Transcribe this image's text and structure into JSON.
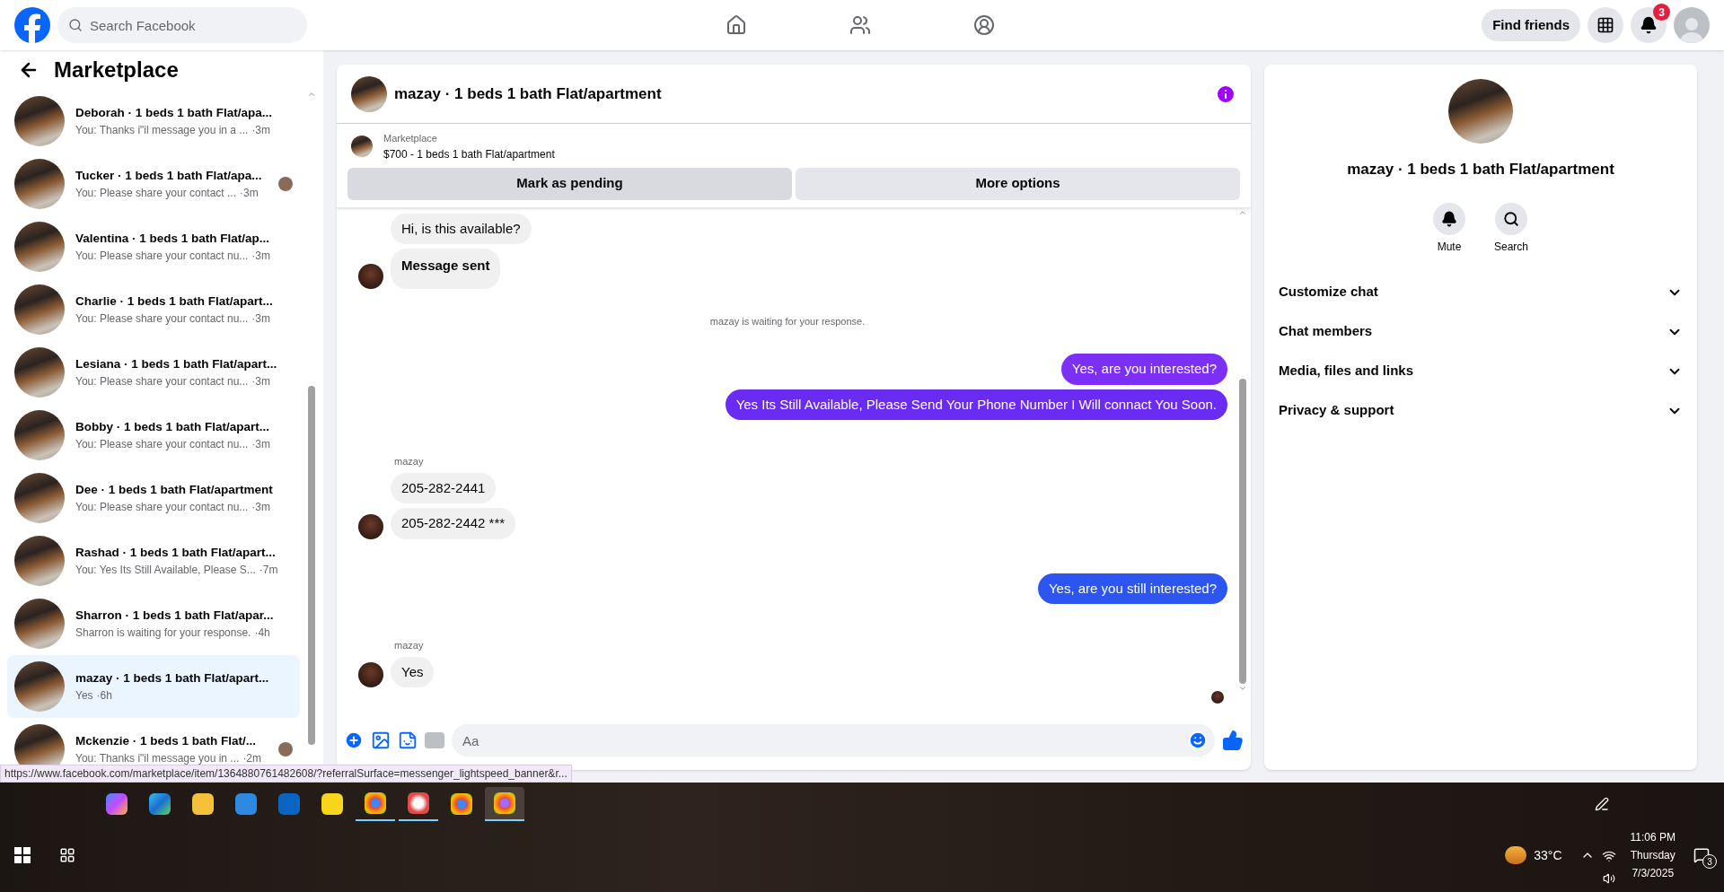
{
  "topbar": {
    "search_placeholder": "Search Facebook",
    "find_friends": "Find friends",
    "notification_count": "3"
  },
  "sidebar": {
    "title": "Marketplace",
    "conversations": [
      {
        "title": "Deborah · 1 beds 1 bath Flat/apa...",
        "preview": "You: Thanks i\"il message you in a ...",
        "time": "·3m",
        "seen_avatar": false,
        "selected": false
      },
      {
        "title": "Tucker · 1 beds 1 bath Flat/apa...",
        "preview": "You: Please share your contact ...",
        "time": "·3m",
        "seen_avatar": true,
        "selected": false
      },
      {
        "title": "Valentina · 1 beds 1 bath Flat/ap...",
        "preview": "You: Please share your contact nu...",
        "time": "·3m",
        "seen_avatar": false,
        "selected": false
      },
      {
        "title": "Charlie · 1 beds 1 bath Flat/apart...",
        "preview": "You: Please share your contact nu...",
        "time": "·3m",
        "seen_avatar": false,
        "selected": false
      },
      {
        "title": "Lesiana · 1 beds 1 bath Flat/apart...",
        "preview": "You: Please share your contact nu...",
        "time": "·3m",
        "seen_avatar": false,
        "selected": false
      },
      {
        "title": "Bobby · 1 beds 1 bath Flat/apart...",
        "preview": "You: Please share your contact nu...",
        "time": "·3m",
        "seen_avatar": false,
        "selected": false
      },
      {
        "title": "Dee · 1 beds 1 bath Flat/apartment",
        "preview": "You: Please share your contact nu...",
        "time": "·3m",
        "seen_avatar": false,
        "selected": false
      },
      {
        "title": "Rashad · 1 beds 1 bath Flat/apart...",
        "preview": "You: Yes Its Still Available, Please S...",
        "time": "·7m",
        "seen_avatar": false,
        "selected": false
      },
      {
        "title": "Sharron · 1 beds 1 bath Flat/apar...",
        "preview": "Sharron is waiting for your response.",
        "time": "·4h",
        "seen_avatar": false,
        "selected": false
      },
      {
        "title": "mazay · 1 beds 1 bath Flat/apart...",
        "preview": "Yes",
        "time": "·6h",
        "seen_avatar": false,
        "selected": true
      },
      {
        "title": "Mckenzie · 1 beds 1 bath Flat/...",
        "preview": "You: Thanks i\"il message you in ...",
        "time": "·2m",
        "seen_avatar": true,
        "selected": false
      }
    ]
  },
  "chat": {
    "title": "mazay · 1 beds 1 bath Flat/apartment",
    "listing": {
      "source": "Marketplace",
      "title": "$700 - 1 beds 1 bath Flat/apartment"
    },
    "buttons": [
      "Mark as pending",
      "More options"
    ],
    "messages": [
      {
        "kind": "incoming",
        "text": "Hi, is this available?",
        "bold": false,
        "avatar": false
      },
      {
        "kind": "incoming",
        "text": "Message sent",
        "bold": true,
        "avatar": true
      },
      {
        "kind": "notice",
        "text": "mazay is waiting for your response."
      },
      {
        "kind": "outgoing",
        "text": "Yes, are you interested?",
        "color": "#7b2ff7"
      },
      {
        "kind": "outgoing",
        "text": "Yes Its Still Available, Please Send Your Phone Number I Will connact You Soon.",
        "color": "#6a2cf5"
      },
      {
        "kind": "incoming",
        "sender": "mazay",
        "text": "205-282-2441",
        "bold": false,
        "avatar": false
      },
      {
        "kind": "incoming",
        "text": "205-282-2442 ***",
        "bold": false,
        "avatar": true
      },
      {
        "kind": "outgoing",
        "text": "Yes, are you still interested?",
        "color": "#2d55f2"
      },
      {
        "kind": "incoming",
        "sender": "mazay",
        "text": "Yes",
        "bold": false,
        "avatar": true
      }
    ],
    "composer_placeholder": "Aa"
  },
  "details": {
    "title": "mazay · 1 beds 1 bath Flat/apartment",
    "actions": [
      "Mute",
      "Search"
    ],
    "sections": [
      "Customize chat",
      "Chat members",
      "Media, files and links",
      "Privacy & support"
    ]
  },
  "status_url": "https://www.facebook.com/marketplace/item/1364880761482608/?referralSurface=messenger_lightspeed_banner&r...",
  "taskbar": {
    "temperature": "33°C",
    "time": "11:06 PM",
    "day": "Thursday",
    "date": "7/3/2025",
    "notifications": "3"
  }
}
